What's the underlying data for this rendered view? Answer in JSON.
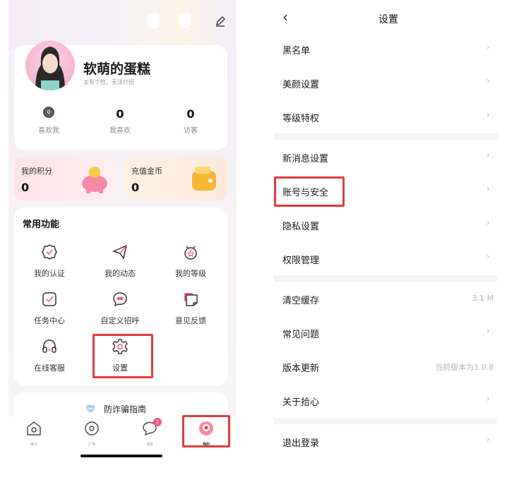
{
  "profile": {
    "username": "软萌的蛋糕",
    "signature": "太有个性，无法介绍",
    "stats": [
      {
        "value": "0",
        "label": "喜欢我"
      },
      {
        "value": "0",
        "label": "我喜欢"
      },
      {
        "value": "0",
        "label": "访客"
      }
    ]
  },
  "wallet": {
    "points_label": "我的积分",
    "points_value": "0",
    "coins_label": "充值金币",
    "coins_value": "0"
  },
  "functions": {
    "title": "常用功能",
    "items": [
      {
        "label": "我的认证",
        "icon": "verify-badge-icon"
      },
      {
        "label": "我的动态",
        "icon": "paper-plane-icon"
      },
      {
        "label": "我的等级",
        "icon": "level-medal-icon"
      },
      {
        "label": "任务中心",
        "icon": "task-check-icon"
      },
      {
        "label": "自定义招呼",
        "icon": "greeting-bubble-icon"
      },
      {
        "label": "意见反馈",
        "icon": "feedback-icon"
      },
      {
        "label": "在线客服",
        "icon": "headset-icon"
      },
      {
        "label": "设置",
        "icon": "settings-gear-icon"
      }
    ]
  },
  "guide_banner": {
    "label": "防诈骗指南"
  },
  "tabbar": {
    "items": [
      {
        "label": "缘分",
        "icon": "fate-icon"
      },
      {
        "label": "广场",
        "icon": "plaza-icon"
      },
      {
        "label": "消息",
        "icon": "message-icon",
        "badge": "1"
      },
      {
        "label": "我的",
        "icon": "profile-icon"
      }
    ]
  },
  "settings": {
    "title": "设置",
    "back_icon": "back-chevron-icon",
    "rows": [
      {
        "label": "黑名单"
      },
      {
        "label": "美颜设置"
      },
      {
        "label": "等级特权"
      },
      {
        "label": "新消息设置"
      },
      {
        "label": "账号与安全"
      },
      {
        "label": "隐私设置"
      },
      {
        "label": "权限管理"
      },
      {
        "label": "清空缓存",
        "value": "3.1 M"
      },
      {
        "label": "常见问题"
      },
      {
        "label": "版本更新",
        "value": "当前版本为3.0.8"
      },
      {
        "label": "关于拾心"
      },
      {
        "label": "退出登录"
      }
    ],
    "chevron": "›"
  },
  "colors": {
    "highlight": "#e23b3b",
    "accent": "#f0588f",
    "wallet_pink": "#fde7ea",
    "wallet_peach": "#fdeee0"
  }
}
